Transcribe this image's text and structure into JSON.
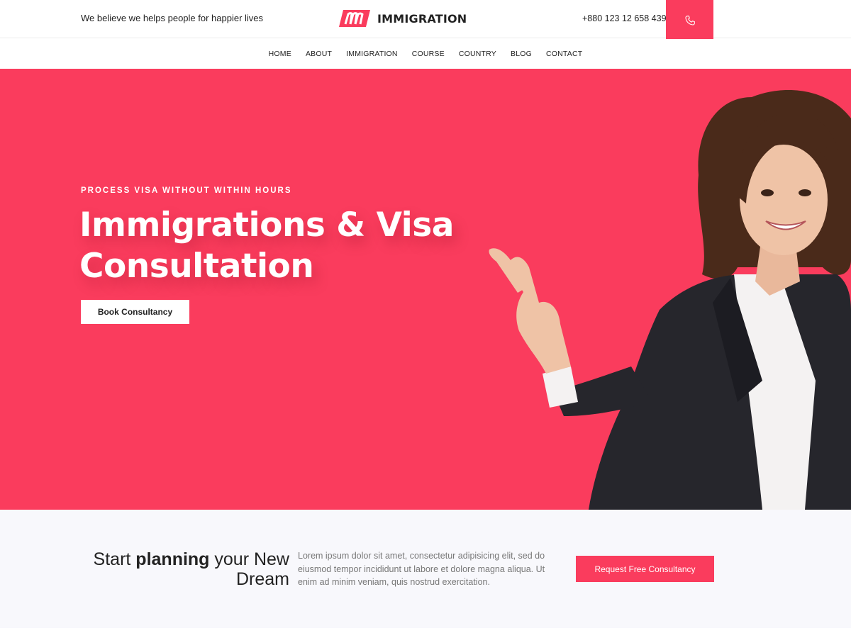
{
  "header": {
    "tagline": "We believe we helps people for happier lives",
    "logo_text": "IMMIGRATION",
    "phone": "+880 123 12 658 439",
    "phone_icon": "phone-icon"
  },
  "nav": {
    "items": [
      "HOME",
      "ABOUT",
      "IMMIGRATION",
      "COURSE",
      "COUNTRY",
      "BLOG",
      "CONTACT"
    ]
  },
  "hero": {
    "kicker": "PROCESS VISA WITHOUT WITHIN HOURS",
    "title_line1": "Immigrations & Visa",
    "title_line2": "Consultation",
    "button": "Book Consultancy"
  },
  "cta": {
    "heading_part1": "Start ",
    "heading_bold": "planning",
    "heading_part2": " your New",
    "heading_line2": "Dream",
    "text": "Lorem ipsum dolor sit amet, consectetur adipisicing elit, sed do eiusmod tempor incididunt ut labore et dolore magna aliqua. Ut enim ad minim veniam, quis nostrud exercitation.",
    "button": "Request Free Consultancy"
  },
  "colors": {
    "accent": "#fa3c5d",
    "band_bg": "#f8f8fc"
  }
}
